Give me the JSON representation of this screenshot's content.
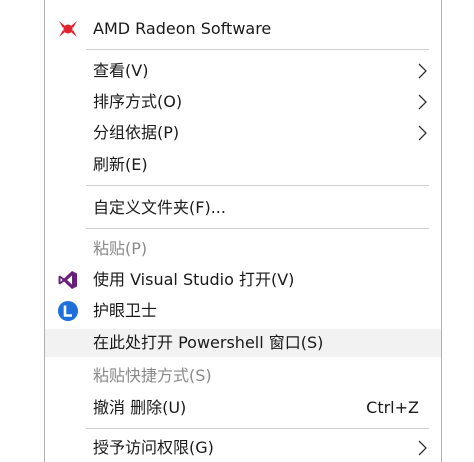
{
  "menu": {
    "items": [
      {
        "label": "AMD Radeon Software",
        "icon": "amd-radeon-icon",
        "disabled": false,
        "submenu": false
      },
      {
        "label": "查看(V)",
        "disabled": false,
        "submenu": true
      },
      {
        "label": "排序方式(O)",
        "disabled": false,
        "submenu": true
      },
      {
        "label": "分组依据(P)",
        "disabled": false,
        "submenu": true
      },
      {
        "label": "刷新(E)",
        "disabled": false,
        "submenu": false
      },
      {
        "label": "自定义文件夹(F)...",
        "disabled": false,
        "submenu": false
      },
      {
        "label": "粘贴(P)",
        "disabled": true,
        "submenu": false
      },
      {
        "label": "使用 Visual Studio 打开(V)",
        "icon": "visual-studio-icon",
        "disabled": false,
        "submenu": false
      },
      {
        "label": "护眼卫士",
        "icon": "eye-guard-icon",
        "disabled": false,
        "submenu": false
      },
      {
        "label": "在此处打开 Powershell 窗口(S)",
        "disabled": false,
        "highlighted": true,
        "submenu": false
      },
      {
        "label": "粘贴快捷方式(S)",
        "disabled": true,
        "submenu": false
      },
      {
        "label": "撤消 删除(U)",
        "shortcut": "Ctrl+Z",
        "disabled": false,
        "submenu": false
      },
      {
        "label": "授予访问权限(G)",
        "disabled": false,
        "submenu": true
      }
    ]
  },
  "colors": {
    "amd_red": "#e0232d",
    "vs_purple": "#68217a",
    "eye_blue": "#1e6fd9",
    "disabled_text": "#8a8a8a",
    "highlight_bg": "#f2f2f2"
  }
}
